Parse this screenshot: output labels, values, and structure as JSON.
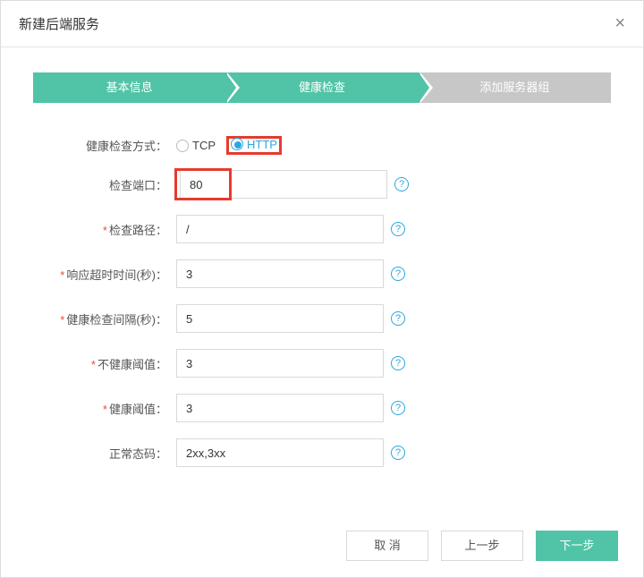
{
  "dialog": {
    "title": "新建后端服务"
  },
  "steps": {
    "items": [
      {
        "label": "基本信息"
      },
      {
        "label": "健康检查"
      },
      {
        "label": "添加服务器组"
      }
    ]
  },
  "form": {
    "check_method": {
      "label": "健康检查方式：",
      "options": {
        "tcp": "TCP",
        "http": "HTTP"
      },
      "selected": "http"
    },
    "port": {
      "label": "检查端口：",
      "value": "80"
    },
    "path": {
      "label": "检查路径：",
      "value": "/"
    },
    "timeout": {
      "label": "响应超时时间(秒)：",
      "value": "3"
    },
    "interval": {
      "label": "健康检查间隔(秒)：",
      "value": "5"
    },
    "unhealthy": {
      "label": "不健康阈值：",
      "value": "3"
    },
    "healthy": {
      "label": "健康阈值：",
      "value": "3"
    },
    "codes": {
      "label": "正常态码：",
      "value": "2xx,3xx"
    }
  },
  "buttons": {
    "cancel": "取 消",
    "prev": "上一步",
    "next": "下一步"
  },
  "asterisk": "*"
}
